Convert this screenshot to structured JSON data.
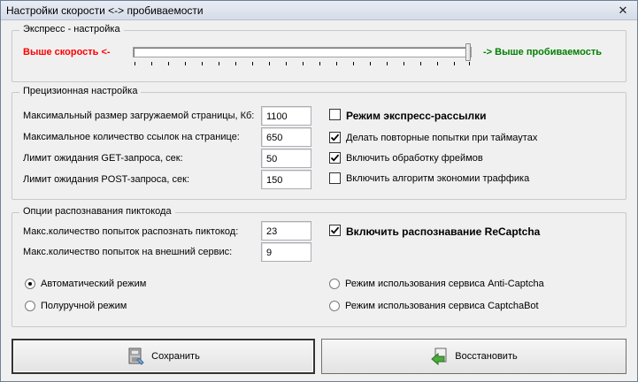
{
  "window": {
    "title": "Настройки скорости <-> пробиваемости",
    "close_glyph": "✕"
  },
  "express": {
    "legend": "Экспресс - настройка",
    "left_label": "Выше скорость <-",
    "right_label": "-> Выше пробиваемость",
    "slider_value": 1.0,
    "colors": {
      "left": "#ff0000",
      "right": "#008000"
    }
  },
  "precision": {
    "legend": "Прецизионная настройка",
    "fields": [
      {
        "label": "Максимальный размер загружаемой страницы, Кб:",
        "value": "1100"
      },
      {
        "label": "Максимальное количество ссылок на странице:",
        "value": "650"
      },
      {
        "label": "Лимит ожидания GET-запроса, сек:",
        "value": "50"
      },
      {
        "label": "Лимит ожидания POST-запроса, сек:",
        "value": "150"
      }
    ],
    "checks": [
      {
        "label": "Режим экспресс-рассылки",
        "checked": false
      },
      {
        "label": "Делать повторные попытки при таймаутах",
        "checked": true
      },
      {
        "label": "Включить обработку фреймов",
        "checked": true
      },
      {
        "label": "Включить алгоритм экономии траффика",
        "checked": false
      }
    ]
  },
  "captcha": {
    "legend": "Опции распознавания пиктокода",
    "fields": [
      {
        "label": "Макс.количество попыток распознать пиктокод:",
        "value": "23"
      },
      {
        "label": "Макс.количество попыток на внешний сервис:",
        "value": "9"
      }
    ],
    "recaptcha_label": "Включить распознавание ReCaptcha",
    "recaptcha_checked": true,
    "radios": [
      {
        "label": "Автоматический режим",
        "selected": true
      },
      {
        "label": "Полуручной режим",
        "selected": false
      },
      {
        "label": "Режим использования сервиса Anti-Captcha",
        "selected": false
      },
      {
        "label": "Режим использования сервиса CaptchaBot",
        "selected": false
      }
    ]
  },
  "buttons": {
    "save_label": "Сохранить",
    "restore_label": "Восстановить"
  }
}
